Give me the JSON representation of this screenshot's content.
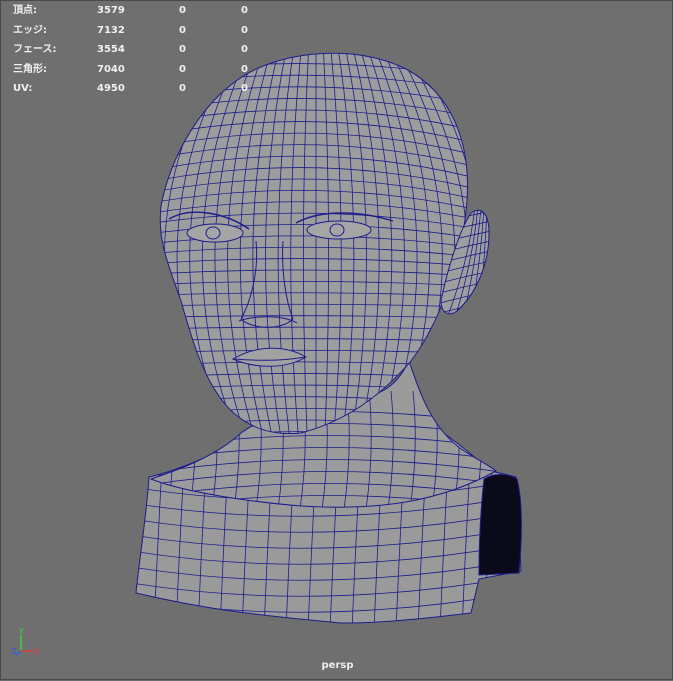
{
  "hud": {
    "rows": [
      {
        "label": "頂点:",
        "total": "3579",
        "selected": "0",
        "extra": "0"
      },
      {
        "label": "エッジ:",
        "total": "7132",
        "selected": "0",
        "extra": "0"
      },
      {
        "label": "フェース:",
        "total": "3554",
        "selected": "0",
        "extra": "0"
      },
      {
        "label": "三角形:",
        "total": "7040",
        "selected": "0",
        "extra": "0"
      },
      {
        "label": "UV:",
        "total": "4950",
        "selected": "0",
        "extra": "0"
      }
    ]
  },
  "viewport": {
    "camera": "persp",
    "background_color": "#6f6f6f",
    "mesh_color": "#999999",
    "wire_color": "#1c1c8c",
    "axis_labels": {
      "x": "X",
      "y": "Y",
      "z": "Z"
    },
    "axis_colors": {
      "x": "#e03a3a",
      "y": "#3ad23a",
      "z": "#3a5ae0"
    }
  }
}
